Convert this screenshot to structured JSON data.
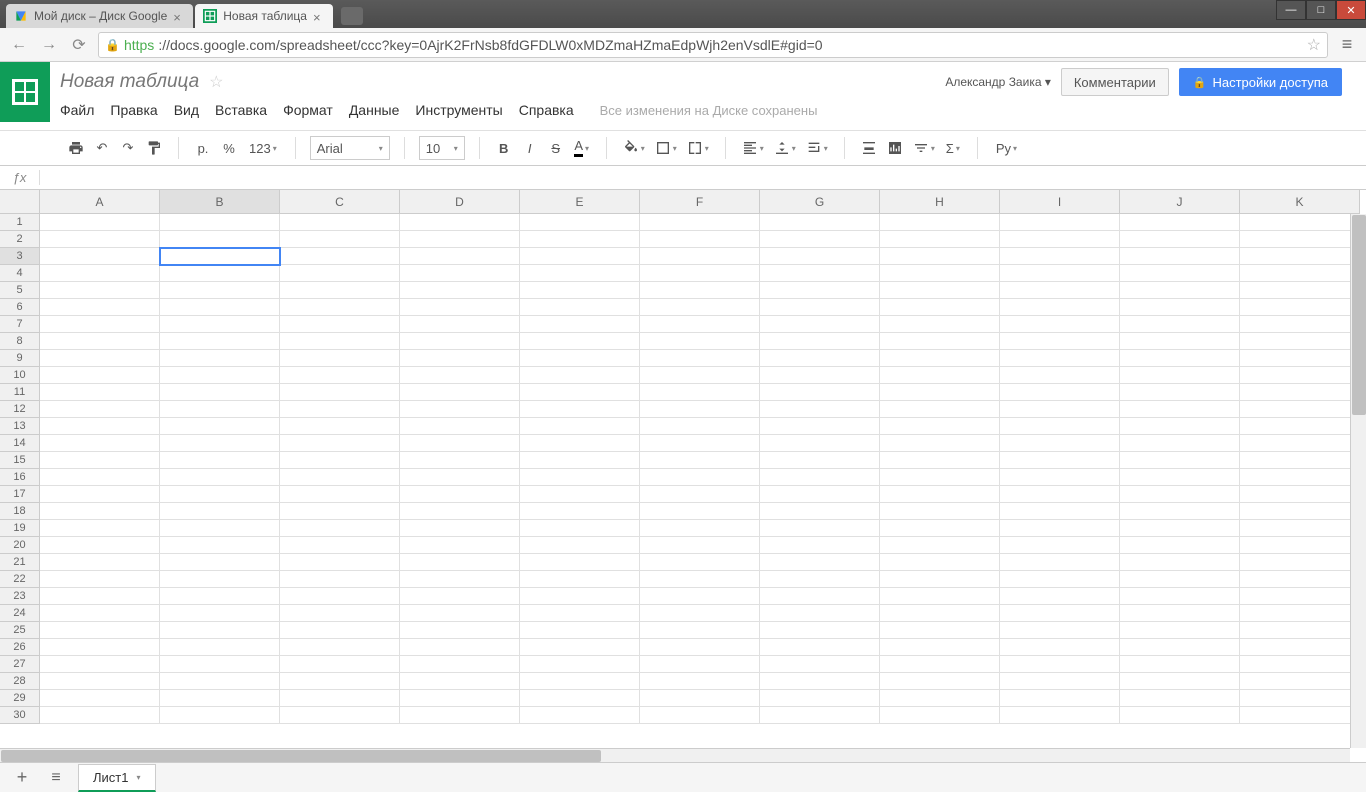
{
  "browser": {
    "tabs": [
      {
        "title": "Мой диск – Диск Google",
        "icon": "drive"
      },
      {
        "title": "Новая таблица",
        "icon": "sheets"
      }
    ],
    "url_https": "https",
    "url_rest": "://docs.google.com/spreadsheet/ccc?key=0AjrK2FrNsb8fdGFDLW0xMDZmaHZmaEdpWjh2enVsdlE#gid=0"
  },
  "doc": {
    "title": "Новая таблица",
    "user": "Александр Заика",
    "comments_btn": "Комментарии",
    "share_btn": "Настройки доступа",
    "save_status": "Все изменения на Диске сохранены"
  },
  "menus": [
    "Файл",
    "Правка",
    "Вид",
    "Вставка",
    "Формат",
    "Данные",
    "Инструменты",
    "Справка"
  ],
  "toolbar": {
    "currency": "р.",
    "percent": "%",
    "decimal": "123",
    "font": "Arial",
    "size": "10",
    "language": "Ру"
  },
  "grid": {
    "columns": [
      "A",
      "B",
      "C",
      "D",
      "E",
      "F",
      "G",
      "H",
      "I",
      "J",
      "K"
    ],
    "rows": 30,
    "selected_col": "B",
    "selected_row": 3
  },
  "sheet_tabs": {
    "tabs": [
      "Лист1"
    ]
  }
}
